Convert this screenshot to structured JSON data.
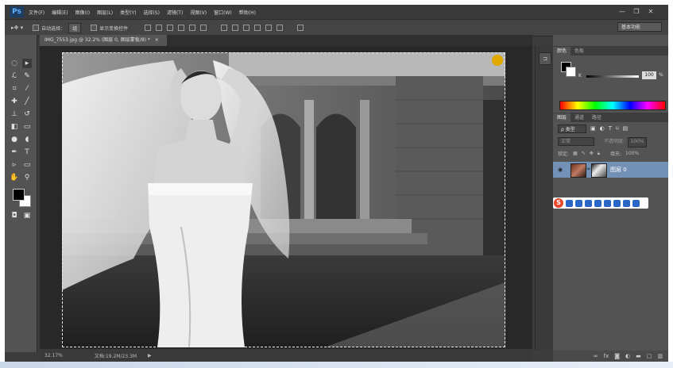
{
  "app": {
    "logo": "Ps",
    "menu": [
      "文件(F)",
      "编辑(E)",
      "图像(I)",
      "图层(L)",
      "类型(Y)",
      "选择(S)",
      "滤镜(T)",
      "视图(V)",
      "窗口(W)",
      "帮助(H)"
    ],
    "window_controls": [
      "—",
      "❐",
      "✕"
    ]
  },
  "options_bar": {
    "auto_select_label": "自动选择：",
    "auto_select_value": "组",
    "transform_label": "显示变换控件",
    "workspace": "基本功能"
  },
  "document": {
    "tab_title": "IMG_7553.jpg @ 32.2% (图层 0, 图层蒙板/8) *",
    "tab_close": "×"
  },
  "status_bar": {
    "zoom": "32.17%",
    "doc_info": "文档:19.2M/23.3M"
  },
  "color_panel": {
    "tabs": [
      "颜色",
      "色板"
    ],
    "channel_label": "K",
    "value": "100",
    "unit": "%"
  },
  "layers_panel": {
    "tabs": [
      "图层",
      "通道",
      "路径"
    ],
    "kind_filter": "ρ 类型",
    "blend_mode": "正常",
    "opacity_label": "不透明度:",
    "opacity_value": "100%",
    "lock_label": "锁定:",
    "fill_label": "填充:",
    "fill_value": "100%",
    "layer_name": "图层 0"
  },
  "colors": {
    "accent": "#7390b6",
    "panel_bg": "#535353"
  }
}
